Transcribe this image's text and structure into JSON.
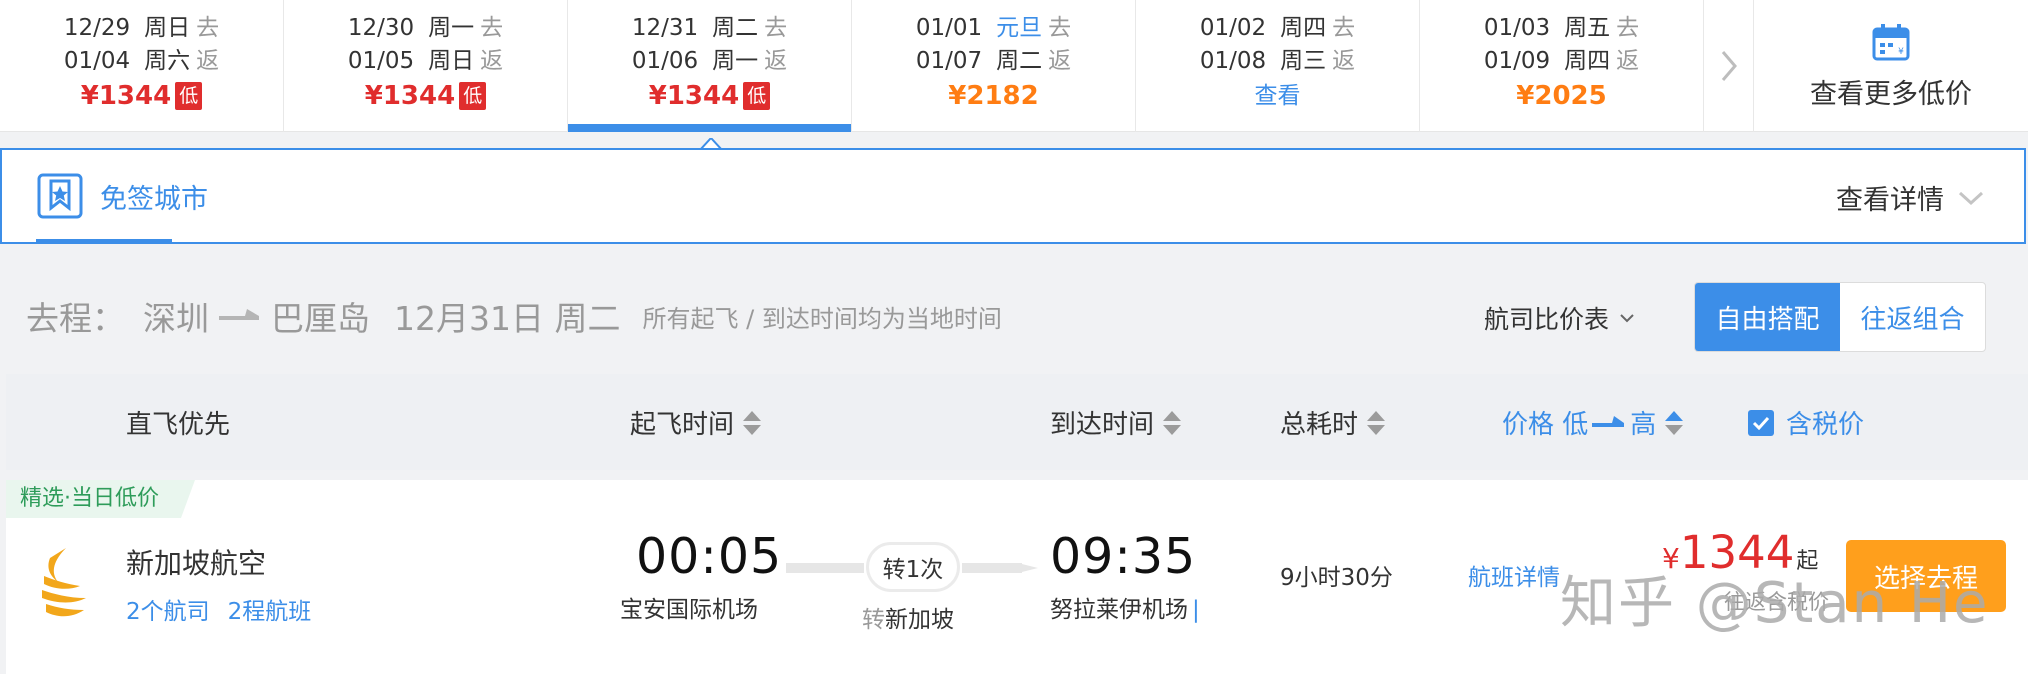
{
  "date_strip": {
    "dates": [
      {
        "out_date": "12/29",
        "out_weekday": "周日",
        "out_tag": "去",
        "ret_date": "01/04",
        "ret_weekday": "周六",
        "ret_tag": "返",
        "price": "¥1344",
        "badge": "低",
        "price_style": "red",
        "active": false
      },
      {
        "out_date": "12/30",
        "out_weekday": "周一",
        "out_tag": "去",
        "ret_date": "01/05",
        "ret_weekday": "周日",
        "ret_tag": "返",
        "price": "¥1344",
        "badge": "低",
        "price_style": "red",
        "active": false
      },
      {
        "out_date": "12/31",
        "out_weekday": "周二",
        "out_tag": "去",
        "ret_date": "01/06",
        "ret_weekday": "周一",
        "ret_tag": "返",
        "price": "¥1344",
        "badge": "低",
        "price_style": "red",
        "active": true
      },
      {
        "out_date": "01/01",
        "out_weekday": "元旦",
        "out_tag": "去",
        "ret_date": "01/07",
        "ret_weekday": "周二",
        "ret_tag": "返",
        "price": "¥2182",
        "badge": "",
        "price_style": "orange",
        "active": false,
        "holiday": true
      },
      {
        "out_date": "01/02",
        "out_weekday": "周四",
        "out_tag": "去",
        "ret_date": "01/08",
        "ret_weekday": "周三",
        "ret_tag": "返",
        "price": "查看",
        "badge": "",
        "price_style": "link",
        "active": false
      },
      {
        "out_date": "01/03",
        "out_weekday": "周五",
        "out_tag": "去",
        "ret_date": "01/09",
        "ret_weekday": "周四",
        "ret_tag": "返",
        "price": "¥2025",
        "badge": "",
        "price_style": "orange",
        "active": false
      }
    ],
    "more_label": "查看更多低价",
    "calendar_icon": "calendar-price-icon",
    "next_icon": "chevron-right-icon"
  },
  "visa_banner": {
    "label": "免签城市",
    "details_label": "查看详情"
  },
  "route": {
    "direction": "去程：",
    "from_city": "深圳",
    "to_city": "巴厘岛",
    "date": "12月31日 周二",
    "time_note": "所有起飞 / 到达时间均为当地时间",
    "airline_compare": "航司比价表",
    "mode_free": "自由搭配",
    "mode_round": "往返组合"
  },
  "sort_bar": {
    "direct_first": "直飞优先",
    "depart_time": "起飞时间",
    "arrive_time": "到达时间",
    "total_duration": "总耗时",
    "price_label": "价格 低",
    "price_high": "高",
    "tax_included": "含税价"
  },
  "flight": {
    "pick_tag": "精选·当日低价",
    "airline": "新加坡航空",
    "airline_count": "2个航司",
    "leg_count": "2程航班",
    "dep_time": "00:05",
    "dep_airport": "宝安国际机场",
    "transfer_label": "转1次",
    "transfer_prefix": "转",
    "transfer_city": "新加坡",
    "arr_time": "09:35",
    "arr_airport": "努拉莱伊机场",
    "duration": "9小时30分",
    "detail_link": "航班详情",
    "currency": "¥",
    "price": "1344",
    "price_suffix": "起",
    "tax_note": "往返含税价",
    "select_label": "选择去程"
  },
  "watermark": "知乎 @Stan He",
  "colors": {
    "accent": "#3c8ee8",
    "price_red": "#e02d2d",
    "price_orange": "#ff7d13",
    "select_button": "#ff9f1c",
    "pick_tag_green": "#2e9c5a"
  }
}
